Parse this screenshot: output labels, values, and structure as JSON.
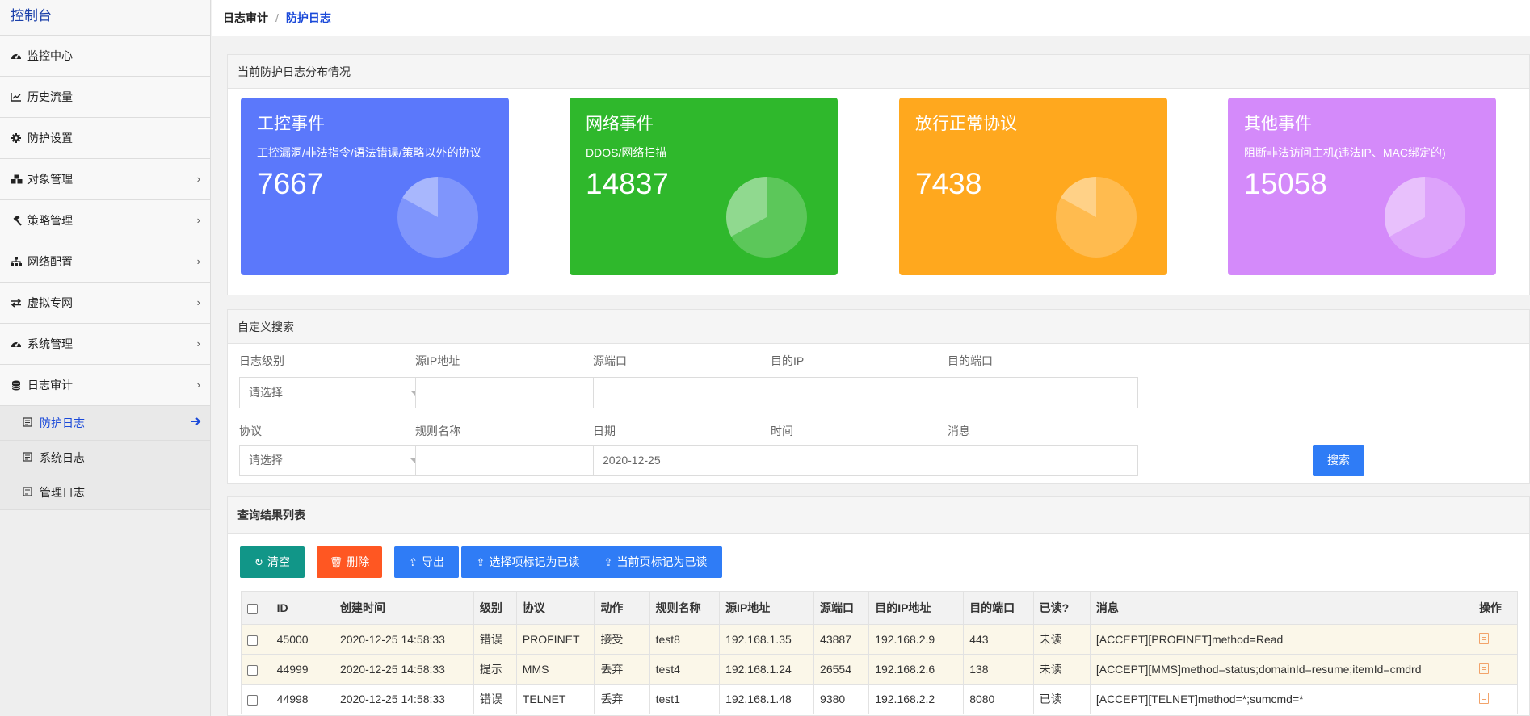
{
  "sidebar": {
    "brand": "控制台",
    "items": [
      {
        "label": "监控中心",
        "icon": "dashboard-icon",
        "has_children": false
      },
      {
        "label": "历史流量",
        "icon": "line-chart-icon",
        "has_children": false
      },
      {
        "label": "防护设置",
        "icon": "gear-icon",
        "has_children": false
      },
      {
        "label": "对象管理",
        "icon": "cubes-icon",
        "has_children": true
      },
      {
        "label": "策略管理",
        "icon": "gavel-icon",
        "has_children": true
      },
      {
        "label": "网络配置",
        "icon": "sitemap-icon",
        "has_children": true
      },
      {
        "label": "虚拟专网",
        "icon": "exchange-icon",
        "has_children": true
      },
      {
        "label": "系统管理",
        "icon": "dashboard-icon",
        "has_children": true
      },
      {
        "label": "日志审计",
        "icon": "database-icon",
        "has_children": true
      }
    ],
    "sub_items": [
      {
        "label": "防护日志",
        "active": true
      },
      {
        "label": "系统日志",
        "active": false
      },
      {
        "label": "管理日志",
        "active": false
      }
    ]
  },
  "breadcrumb": {
    "parent": "日志审计",
    "separator": "/",
    "current": "防护日志"
  },
  "distribution": {
    "title": "当前防护日志分布情况",
    "cards": [
      {
        "title": "工控事件",
        "subtitle": "工控漏洞/非法指令/语法错误/策略以外的协议",
        "value": "7667",
        "share": 0.17,
        "color": "#5b78fb"
      },
      {
        "title": "网络事件",
        "subtitle": "DDOS/网络扫描",
        "value": "14837",
        "share": 0.33,
        "color": "#2fb82c"
      },
      {
        "title": "放行正常协议",
        "subtitle": "",
        "value": "7438",
        "share": 0.17,
        "color": "#ffa81e"
      },
      {
        "title": "其他事件",
        "subtitle": "阻断非法访问主机(违法IP、MAC绑定的)",
        "value": "15058",
        "share": 0.33,
        "color": "#d48afa"
      }
    ]
  },
  "search": {
    "title": "自定义搜索",
    "row1": [
      {
        "label": "日志级别",
        "value": "请选择",
        "type": "select"
      },
      {
        "label": "源IP地址",
        "value": "",
        "type": "input"
      },
      {
        "label": "源端口",
        "value": "",
        "type": "input"
      },
      {
        "label": "目的IP",
        "value": "",
        "type": "input"
      },
      {
        "label": "目的端口",
        "value": "",
        "type": "input"
      }
    ],
    "row2": [
      {
        "label": "协议",
        "value": "请选择",
        "type": "select"
      },
      {
        "label": "规则名称",
        "value": "",
        "type": "input"
      },
      {
        "label": "日期",
        "value": "2020-12-25",
        "type": "input"
      },
      {
        "label": "时间",
        "value": "",
        "type": "input"
      },
      {
        "label": "消息",
        "value": "",
        "type": "input"
      }
    ],
    "button": "搜索"
  },
  "results": {
    "title": "查询结果列表",
    "buttons": [
      {
        "label": "清空",
        "icon": "refresh-icon",
        "color": "#119688"
      },
      {
        "label": "删除",
        "icon": "trash-icon",
        "color": "#ff5722"
      },
      {
        "label": "导出",
        "icon": "export-icon",
        "color": "#2f7cf6"
      },
      {
        "label": "选择项标记为已读",
        "icon": "mark-icon",
        "color": "#2f7cf6"
      },
      {
        "label": "当前页标记为已读",
        "icon": "mark-icon",
        "color": "#2f7cf6"
      }
    ],
    "columns": [
      "ID",
      "创建时间",
      "级别",
      "协议",
      "动作",
      "规则名称",
      "源IP地址",
      "源端口",
      "目的IP地址",
      "目的端口",
      "已读?",
      "消息",
      "操作"
    ],
    "rows": [
      {
        "id": "45000",
        "time": "2020-12-25 14:58:33",
        "level": "错误",
        "protocol": "PROFINET",
        "action": "接受",
        "rule": "test8",
        "src_ip": "192.168.1.35",
        "src_port": "43887",
        "dst_ip": "192.168.2.9",
        "dst_port": "443",
        "read": "未读",
        "message": "[ACCEPT][PROFINET]method=Read"
      },
      {
        "id": "44999",
        "time": "2020-12-25 14:58:33",
        "level": "提示",
        "protocol": "MMS",
        "action": "丢弃",
        "rule": "test4",
        "src_ip": "192.168.1.24",
        "src_port": "26554",
        "dst_ip": "192.168.2.6",
        "dst_port": "138",
        "read": "未读",
        "message": "[ACCEPT][MMS]method=status;domainId=resume;itemId=cmdrd"
      },
      {
        "id": "44998",
        "time": "2020-12-25 14:58:33",
        "level": "错误",
        "protocol": "TELNET",
        "action": "丢弃",
        "rule": "test1",
        "src_ip": "192.168.1.48",
        "src_port": "9380",
        "dst_ip": "192.168.2.2",
        "dst_port": "8080",
        "read": "已读",
        "message": "[ACCEPT][TELNET]method=*;sumcmd=*"
      }
    ]
  }
}
